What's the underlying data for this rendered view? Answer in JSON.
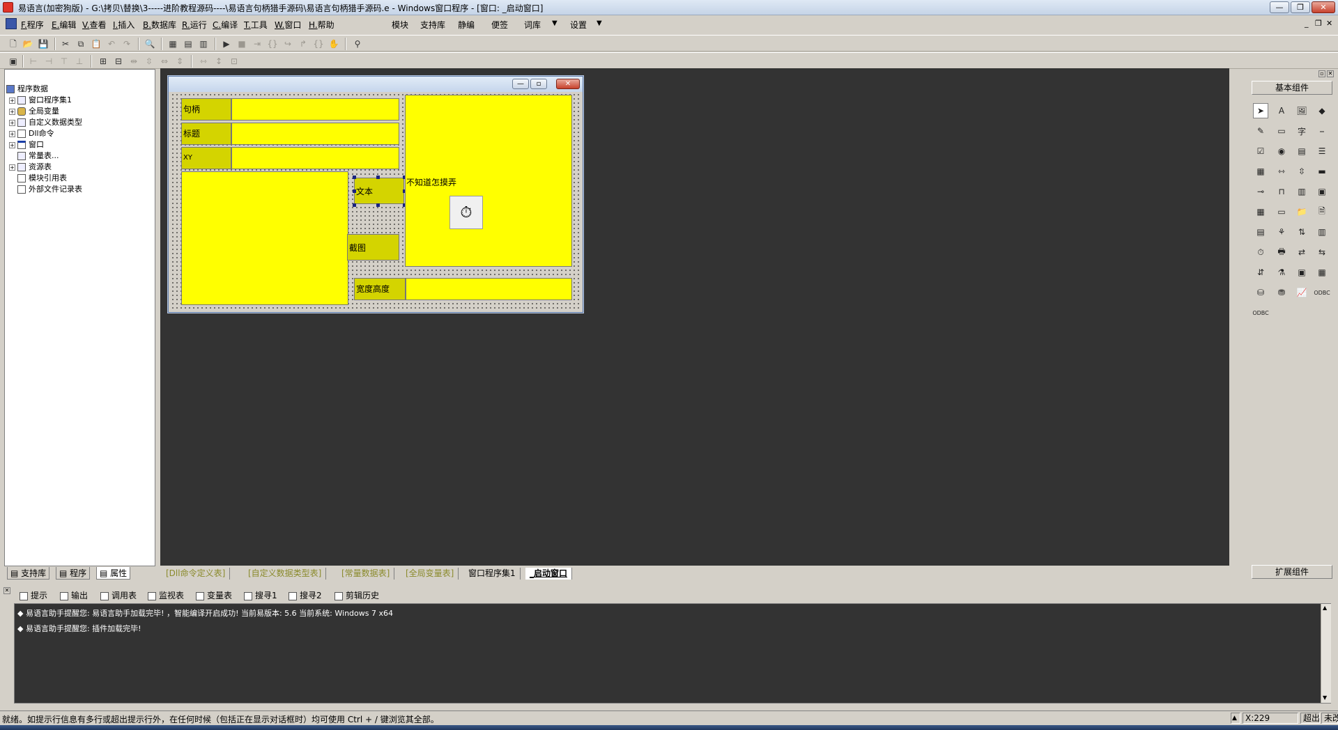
{
  "window": {
    "title": "易语言(加密狗版) - G:\\拷贝\\替换\\3-----进阶教程源码----\\易语言句柄猎手源码\\易语言句柄猎手源码.e - Windows窗口程序 - [窗口: _启动窗口]",
    "buttons": [
      "minimize-icon",
      "restore-icon",
      "close-icon"
    ]
  },
  "menubar": {
    "items": [
      {
        "acc": "F.",
        "label": "程序"
      },
      {
        "acc": "E.",
        "label": "编辑"
      },
      {
        "acc": "V.",
        "label": "查看"
      },
      {
        "acc": "I.",
        "label": "插入"
      },
      {
        "acc": "B.",
        "label": "数据库"
      },
      {
        "acc": "R.",
        "label": "运行"
      },
      {
        "acc": "C.",
        "label": "编译"
      },
      {
        "acc": "T.",
        "label": "工具"
      },
      {
        "acc": "W.",
        "label": "窗口"
      },
      {
        "acc": "H.",
        "label": "帮助"
      }
    ],
    "top_buttons": [
      "模块",
      "支持库",
      "静编",
      "便签",
      "词库",
      "设置"
    ]
  },
  "left_panel": {
    "tree": [
      {
        "label": "程序数据",
        "icon": "program-data-icon"
      },
      {
        "label": "窗口程序集1",
        "icon": "assembly-icon"
      },
      {
        "label": "全局变量",
        "icon": "global-var-icon"
      },
      {
        "label": "自定义数据类型",
        "icon": "datatype-icon"
      },
      {
        "label": "Dll命令",
        "icon": "dll-icon"
      },
      {
        "label": "窗口",
        "icon": "window-icon"
      },
      {
        "label": "常量表...",
        "icon": "constant-icon"
      },
      {
        "label": "资源表",
        "icon": "resource-icon"
      },
      {
        "label": "模块引用表",
        "icon": "module-icon"
      },
      {
        "label": "外部文件记录表",
        "icon": "file-icon"
      }
    ],
    "tabs": [
      "支持库",
      "程序",
      "属性"
    ],
    "active_tab": "属性"
  },
  "form": {
    "labels": {
      "handle": "句柄",
      "title": "标题",
      "xy": "XY",
      "text": "文本",
      "unknown": "不知道怎摸弄",
      "screenshot": "截图",
      "widthheight": "宽度高度"
    }
  },
  "doc_tabs": [
    "[Dll命令定义表]",
    "[自定义数据类型表]",
    "[常量数据表]",
    "[全局变量表]",
    "窗口程序集1",
    "_启动窗口"
  ],
  "active_doc_tab": "_启动窗口",
  "right_panel": {
    "title": "基本组件",
    "footer": "扩展组件"
  },
  "output": {
    "tabs": [
      "提示",
      "输出",
      "调用表",
      "监视表",
      "变量表",
      "搜寻1",
      "搜寻2",
      "剪辑历史"
    ],
    "lines": [
      "易语言助手提醒您: 易语言助手加载完毕! ，智能编译开启成功! 当前易版本: 5.6 当前系统: Windows 7 x64",
      "易语言助手提醒您: 插件加载完毕!"
    ]
  },
  "statusbar": {
    "message": "就绪。如提示行信息有多行或超出提示行外，在任何时候（包括正在显示对话框时）均可使用 Ctrl + / 键浏览其全部。",
    "coord": "X:229",
    "mode": "超出",
    "edit": "未改"
  }
}
